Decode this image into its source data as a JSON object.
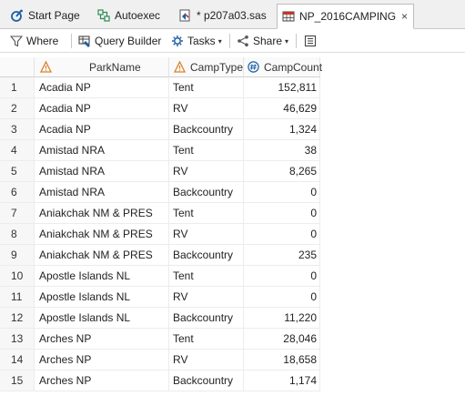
{
  "tabs": [
    {
      "label": "Start Page",
      "icon": "start-page-icon"
    },
    {
      "label": "Autoexec",
      "icon": "flow-icon"
    },
    {
      "label": "* p207a03.sas",
      "icon": "sas-program-icon"
    },
    {
      "label": "NP_2016CAMPING",
      "icon": "table-icon",
      "close": "×",
      "active": true
    }
  ],
  "toolbar": {
    "where": "Where",
    "query_builder": "Query Builder",
    "tasks": "Tasks",
    "share": "Share",
    "caret": "▾"
  },
  "columns": [
    {
      "label": "ParkName",
      "type": "character",
      "icon": "warning-triangle-icon"
    },
    {
      "label": "CampType",
      "type": "character",
      "icon": "warning-triangle-icon"
    },
    {
      "label": "CampCount",
      "type": "numeric",
      "icon": "numeric-circle-icon"
    }
  ],
  "rows": [
    {
      "n": "1",
      "park": "Acadia NP",
      "type": "Tent",
      "count": "152,811"
    },
    {
      "n": "2",
      "park": "Acadia NP",
      "type": "RV",
      "count": "46,629"
    },
    {
      "n": "3",
      "park": "Acadia NP",
      "type": "Backcountry",
      "count": "1,324"
    },
    {
      "n": "4",
      "park": "Amistad NRA",
      "type": "Tent",
      "count": "38"
    },
    {
      "n": "5",
      "park": "Amistad NRA",
      "type": "RV",
      "count": "8,265"
    },
    {
      "n": "6",
      "park": "Amistad NRA",
      "type": "Backcountry",
      "count": "0"
    },
    {
      "n": "7",
      "park": "Aniakchak NM & PRES",
      "type": "Tent",
      "count": "0"
    },
    {
      "n": "8",
      "park": "Aniakchak NM & PRES",
      "type": "RV",
      "count": "0"
    },
    {
      "n": "9",
      "park": "Aniakchak NM & PRES",
      "type": "Backcountry",
      "count": "235"
    },
    {
      "n": "10",
      "park": "Apostle Islands NL",
      "type": "Tent",
      "count": "0"
    },
    {
      "n": "11",
      "park": "Apostle Islands NL",
      "type": "RV",
      "count": "0"
    },
    {
      "n": "12",
      "park": "Apostle Islands NL",
      "type": "Backcountry",
      "count": "11,220"
    },
    {
      "n": "13",
      "park": "Arches NP",
      "type": "Tent",
      "count": "28,046"
    },
    {
      "n": "14",
      "park": "Arches NP",
      "type": "RV",
      "count": "18,658"
    },
    {
      "n": "15",
      "park": "Arches NP",
      "type": "Backcountry",
      "count": "1,174"
    }
  ]
}
